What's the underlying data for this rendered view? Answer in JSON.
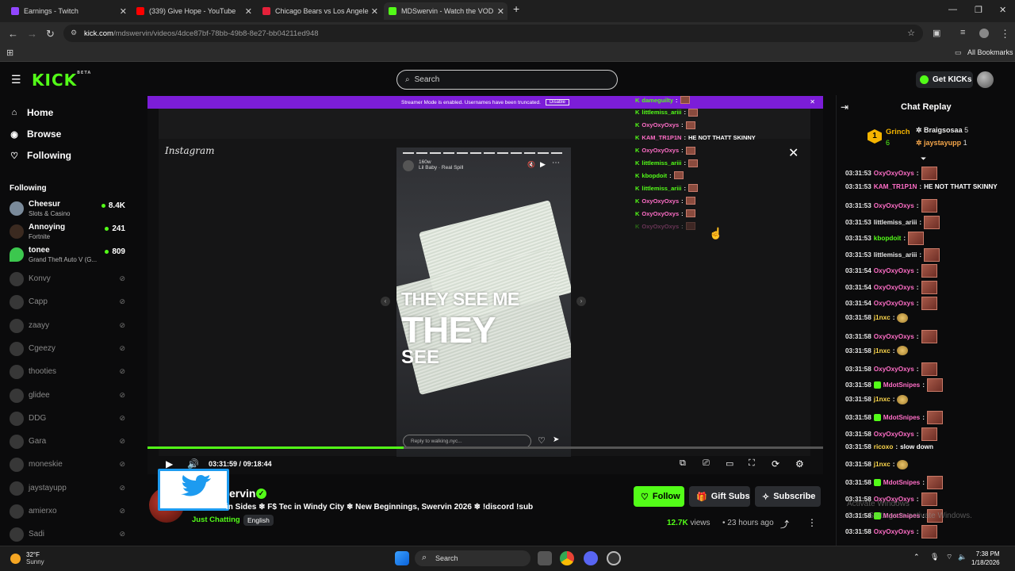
{
  "browser": {
    "tabs": [
      {
        "title": "Earnings - Twitch",
        "color": "#9146ff"
      },
      {
        "title": "(339) Give Hope - YouTube",
        "color": "#ff0000"
      },
      {
        "title": "Chicago Bears vs Los Angeles R",
        "color": "#e5213a"
      },
      {
        "title": "MDSwervin - Watch the VOD o",
        "color": "#53fc18"
      }
    ],
    "new_tab": "+",
    "url_host": "kick.com",
    "url_path": "/mdswervin/videos/4dce87bf-78bb-49b8-8e27-bb04211ed948",
    "all_bookmarks": "All Bookmarks"
  },
  "kick": {
    "logo": "KICK",
    "logo_sup": "BETA",
    "search_placeholder": "Search",
    "get_kicks": "Get KICKs"
  },
  "sidebar": {
    "nav": [
      {
        "label": "Home",
        "icon": "home-icon"
      },
      {
        "label": "Browse",
        "icon": "browse-icon"
      },
      {
        "label": "Following",
        "icon": "heart-icon"
      }
    ],
    "following_header": "Following",
    "live": [
      {
        "name": "Cheesur",
        "game": "Slots & Casino",
        "viewers": "8.4K"
      },
      {
        "name": "Annoying",
        "game": "Fortnite",
        "viewers": "241"
      },
      {
        "name": "tonee",
        "game": "Grand Theft Auto V (G...",
        "viewers": "809"
      }
    ],
    "offline": [
      "Konvy",
      "Capp",
      "zaayy",
      "Cgeezy",
      "thooties",
      "glidee",
      "DDG",
      "Gara",
      "moneskie",
      "jaystayupp",
      "amierxo",
      "Sadi"
    ]
  },
  "player": {
    "banner_text": "Streamer Mode is enabled. Usernames have been truncated.",
    "banner_button": "Disable",
    "instagram_logo": "Instagram",
    "story_user": "160w",
    "story_song": "Lil Baby · Real Spill",
    "caption_1": "THEY SEE ME",
    "caption_2": "THEY",
    "caption_3": "SEE",
    "reply_placeholder": "Reply to walking.nyc...",
    "overlay_chat": [
      {
        "user": "dameguilty",
        "msg": "",
        "color": "#53fc18"
      },
      {
        "user": "littlemiss_ariii",
        "msg": "",
        "color": "#53fc18"
      },
      {
        "user": "OxyOxyOxys",
        "msg": "",
        "color": "#ff6ec7"
      },
      {
        "user": "KAM_TR1P1N",
        "msg": "HE NOT THATT SKINNY",
        "color": "#ff6ec7"
      },
      {
        "user": "OxyOxyOxys",
        "msg": "",
        "color": "#ff6ec7"
      },
      {
        "user": "littlemiss_ariii",
        "msg": "",
        "color": "#53fc18"
      },
      {
        "user": "kbopdoit",
        "msg": "",
        "color": "#53fc18"
      },
      {
        "user": "littlemiss_ariii",
        "msg": "",
        "color": "#53fc18"
      },
      {
        "user": "OxyOxyOxys",
        "msg": "",
        "color": "#ff6ec7"
      },
      {
        "user": "OxyOxyOxys",
        "msg": "",
        "color": "#ff6ec7"
      },
      {
        "user": "OxyOxyOxys",
        "msg": "",
        "color": "#ff6ec7"
      }
    ],
    "time_current": "03:31:59",
    "time_total": "09:18:44",
    "time_separator": "/",
    "progress_fraction": 0.3786
  },
  "channel": {
    "name": "ervin",
    "title": "in Sides ❄ F$ Tec in Windy City ❄ New Beginnings, Swervin 2026 ❄ !discord !sub",
    "category": "Just Chatting",
    "language": "English",
    "follow": "Follow",
    "gift": "Gift Subs",
    "subscribe": "Subscribe",
    "views": "12.7K",
    "views_label": "views",
    "ago": "23 hours ago",
    "dot": "•"
  },
  "chat": {
    "title": "Chat Replay",
    "leader": [
      {
        "name": "Grinch",
        "count": "6",
        "rank": "1"
      },
      {
        "name": "Braigsosaa",
        "count": "5"
      },
      {
        "name": "jaystayupp",
        "count": "1"
      }
    ],
    "messages": [
      {
        "ts": "03:31:53",
        "user": "OxyOxyOxys",
        "color": "#ff6ec7",
        "msg": "",
        "emote": "big",
        "badge": false
      },
      {
        "ts": "03:31:53",
        "user": "KAM_TR1P1N",
        "color": "#ff6ec7",
        "msg": "HE NOT THATT SKINNY",
        "emote": "",
        "badge": false
      },
      {
        "ts": "03:31:53",
        "user": "OxyOxyOxys",
        "color": "#ff6ec7",
        "msg": "",
        "emote": "big",
        "badge": false
      },
      {
        "ts": "03:31:53",
        "user": "littlemiss_ariii",
        "color": "#e6e6e6",
        "msg": "",
        "emote": "big",
        "badge": false
      },
      {
        "ts": "03:31:53",
        "user": "kbopdoit",
        "color": "#53fc18",
        "msg": "",
        "emote": "big",
        "badge": false
      },
      {
        "ts": "03:31:53",
        "user": "littlemiss_ariii",
        "color": "#e6e6e6",
        "msg": "",
        "emote": "big",
        "badge": false
      },
      {
        "ts": "03:31:54",
        "user": "OxyOxyOxys",
        "color": "#ff6ec7",
        "msg": "",
        "emote": "big",
        "badge": false
      },
      {
        "ts": "03:31:54",
        "user": "OxyOxyOxys",
        "color": "#ff6ec7",
        "msg": "",
        "emote": "big",
        "badge": false
      },
      {
        "ts": "03:31:54",
        "user": "OxyOxyOxys",
        "color": "#ff6ec7",
        "msg": "",
        "emote": "big",
        "badge": false
      },
      {
        "ts": "03:31:58",
        "user": "j1nxc",
        "color": "#ffd84d",
        "msg": "",
        "emote": "small",
        "badge": false
      },
      {
        "ts": "03:31:58",
        "user": "OxyOxyOxys",
        "color": "#ff6ec7",
        "msg": "",
        "emote": "big",
        "badge": false
      },
      {
        "ts": "03:31:58",
        "user": "j1nxc",
        "color": "#ffd84d",
        "msg": "",
        "emote": "small",
        "badge": false
      },
      {
        "ts": "03:31:58",
        "user": "OxyOxyOxys",
        "color": "#ff6ec7",
        "msg": "",
        "emote": "big",
        "badge": false
      },
      {
        "ts": "03:31:58",
        "user": "MdotSnipes",
        "color": "#ff6ec7",
        "msg": "",
        "emote": "big",
        "badge": true
      },
      {
        "ts": "03:31:58",
        "user": "j1nxc",
        "color": "#ffd84d",
        "msg": "",
        "emote": "small",
        "badge": false
      },
      {
        "ts": "03:31:58",
        "user": "MdotSnipes",
        "color": "#ff6ec7",
        "msg": "",
        "emote": "big",
        "badge": true
      },
      {
        "ts": "03:31:58",
        "user": "OxyOxyOxys",
        "color": "#ff6ec7",
        "msg": "",
        "emote": "big",
        "badge": false
      },
      {
        "ts": "03:31:58",
        "user": "ricoxo",
        "color": "#ffd84d",
        "msg": "slow down",
        "emote": "",
        "badge": false
      },
      {
        "ts": "03:31:58",
        "user": "j1nxc",
        "color": "#ffd84d",
        "msg": "",
        "emote": "small",
        "badge": false
      },
      {
        "ts": "03:31:58",
        "user": "MdotSnipes",
        "color": "#ff6ec7",
        "msg": "",
        "emote": "big",
        "badge": true
      },
      {
        "ts": "03:31:58",
        "user": "OxyOxyOxys",
        "color": "#ff6ec7",
        "msg": "",
        "emote": "big",
        "badge": false
      },
      {
        "ts": "03:31:58",
        "user": "MdotSnipes",
        "color": "#ff6ec7",
        "msg": "",
        "emote": "big",
        "badge": true
      },
      {
        "ts": "03:31:58",
        "user": "OxyOxyOxys",
        "color": "#ff6ec7",
        "msg": "",
        "emote": "big",
        "badge": false
      }
    ],
    "activate_line1": "Activate Windows",
    "activate_line2": "Go to Settings to activate Windows."
  },
  "taskbar": {
    "temp": "32°F",
    "condition": "Sunny",
    "search": "Search",
    "time": "7:38 PM",
    "date": "1/18/2026"
  },
  "colors": {
    "kick_green": "#53fc18",
    "banner_purple": "#7c1dd8"
  }
}
